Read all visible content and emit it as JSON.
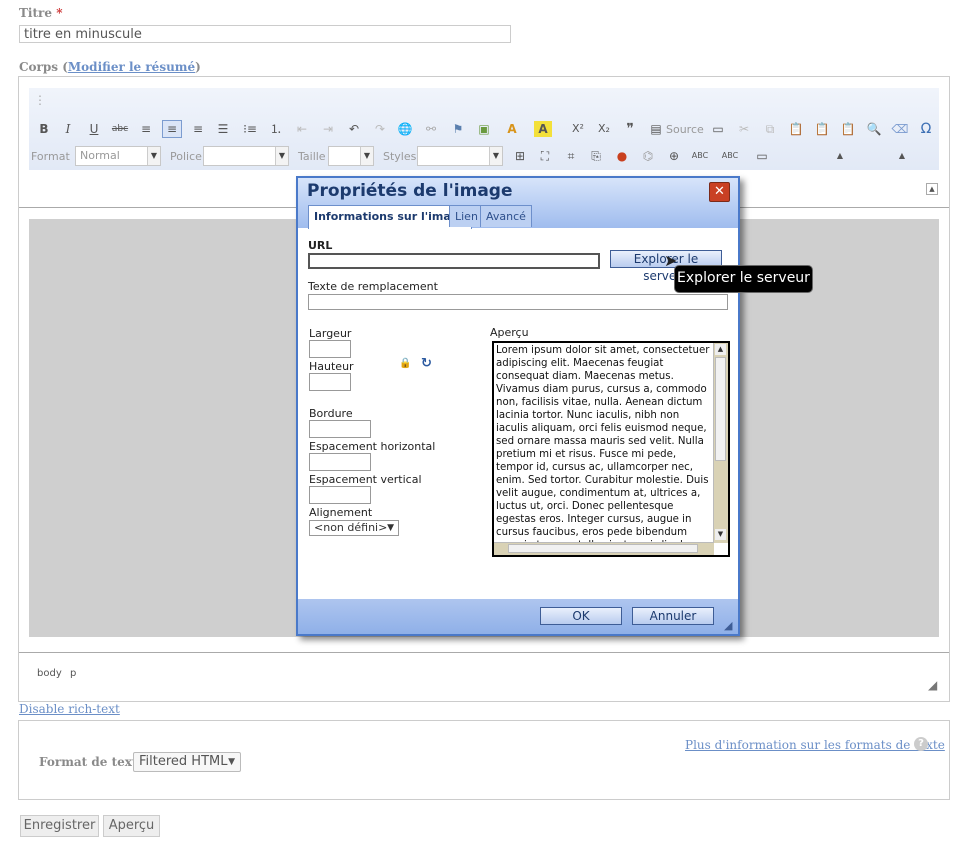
{
  "title_field": {
    "label": "Titre",
    "required_mark": "*",
    "value": "titre en minuscule"
  },
  "body_field": {
    "label_prefix": "Corps (",
    "link": "Modifier le résumé",
    "label_suffix": ")"
  },
  "toolbar": {
    "row1_icons": [
      "bold-icon",
      "italic-icon",
      "underline-icon",
      "strikethrough-icon",
      "align-left-icon",
      "align-center-icon",
      "align-right-icon",
      "justify-icon",
      "bulleted-list-icon",
      "numbered-list-icon",
      "outdent-icon",
      "indent-icon",
      "undo-icon",
      "redo-icon",
      "link-icon",
      "unlink-icon",
      "anchor-icon",
      "image-icon",
      "text-color-icon",
      "bg-color-icon",
      "superscript-icon",
      "subscript-icon",
      "blockquote-icon",
      "source-icon",
      "hr-icon",
      "cut-icon",
      "copy-icon",
      "paste-icon",
      "paste-text-icon",
      "paste-word-icon",
      "find-icon",
      "remove-format-icon",
      "special-char-icon"
    ],
    "source_label": "Source",
    "format_label": "Format",
    "format_value": "Normal",
    "font_label": "Police",
    "size_label": "Taille",
    "styles_label": "Styles"
  },
  "status_path": {
    "body": "body",
    "p": "p"
  },
  "dialog": {
    "title": "Propriétés de l'image",
    "close": "✕",
    "tabs": [
      "Informations sur l'image",
      "Lien",
      "Avancé"
    ],
    "url_label": "URL",
    "url_value": "",
    "browse_button": "Explorer le serveur",
    "alt_label": "Texte de remplacement",
    "width_label": "Largeur",
    "height_label": "Hauteur",
    "border_label": "Bordure",
    "hspace_label": "Espacement horizontal",
    "vspace_label": "Espacement vertical",
    "align_label": "Alignement",
    "align_value": "<non défini>",
    "preview_label": "Aperçu",
    "preview_text": "Lorem ipsum dolor sit amet, consectetuer adipiscing elit. Maecenas feugiat consequat diam. Maecenas metus. Vivamus diam purus, cursus a, commodo non, facilisis vitae, nulla. Aenean dictum lacinia tortor. Nunc iaculis, nibh non iaculis aliquam, orci felis euismod neque, sed ornare massa mauris sed velit. Nulla pretium mi et risus. Fusce mi pede, tempor id, cursus ac, ullamcorper nec, enim. Sed tortor. Curabitur molestie. Duis velit augue, condimentum at, ultrices a, luctus ut, orci. Donec pellentesque egestas eros. Integer cursus, augue in cursus faucibus, eros pede bibendum sem, in tempus tellus justo quis ligula. Etiam eget tortor. Vestibulum",
    "ok": "OK",
    "cancel": "Annuler"
  },
  "tooltip": "Explorer le serveur",
  "disable_richtext": "Disable rich-text",
  "text_format": {
    "label": "Format de texte",
    "value": "Filtered HTML",
    "more_info": "Plus d'information sur les formats de texte"
  },
  "buttons": {
    "save": "Enregistrer",
    "preview": "Aperçu"
  },
  "colors": {
    "dialog_border": "#4a79c9",
    "dialog_head": "#9fbcee",
    "link": "#6b8fc7"
  }
}
